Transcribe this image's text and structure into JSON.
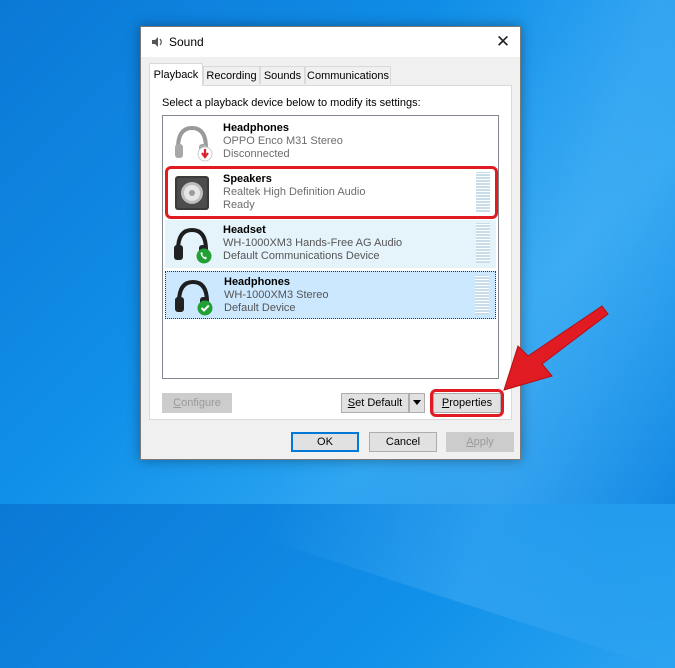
{
  "dialog": {
    "title": "Sound",
    "close_glyph": "✕"
  },
  "tabs": [
    {
      "label": "Playback",
      "active": true
    },
    {
      "label": "Recording",
      "active": false
    },
    {
      "label": "Sounds",
      "active": false
    },
    {
      "label": "Communications",
      "active": false
    }
  ],
  "instruction": "Select a playback device below to modify its settings:",
  "devices": [
    {
      "name": "Headphones",
      "description": "OPPO Enco M31 Stereo",
      "status": "Disconnected",
      "icon": "headphones-disconnected-icon"
    },
    {
      "name": "Speakers",
      "description": "Realtek High Definition Audio",
      "status": "Ready",
      "icon": "speaker-icon"
    },
    {
      "name": "Headset",
      "description": "WH-1000XM3 Hands-Free AG Audio",
      "status": "Default Communications Device",
      "icon": "headset-communications-icon"
    },
    {
      "name": "Headphones",
      "description": "WH-1000XM3 Stereo",
      "status": "Default Device",
      "icon": "headphones-default-icon"
    }
  ],
  "buttons": {
    "configure_first": "C",
    "configure_rest": "onfigure",
    "set_default_first": "S",
    "set_default_rest": "et Default",
    "properties_first": "P",
    "properties_rest": "roperties",
    "ok": "OK",
    "cancel": "Cancel",
    "apply_first": "A",
    "apply_rest": "pply"
  },
  "colors": {
    "annotation_red": "#e11b22",
    "selection_blue": "#cce8ff",
    "desktop_blue": "#1191ea"
  }
}
